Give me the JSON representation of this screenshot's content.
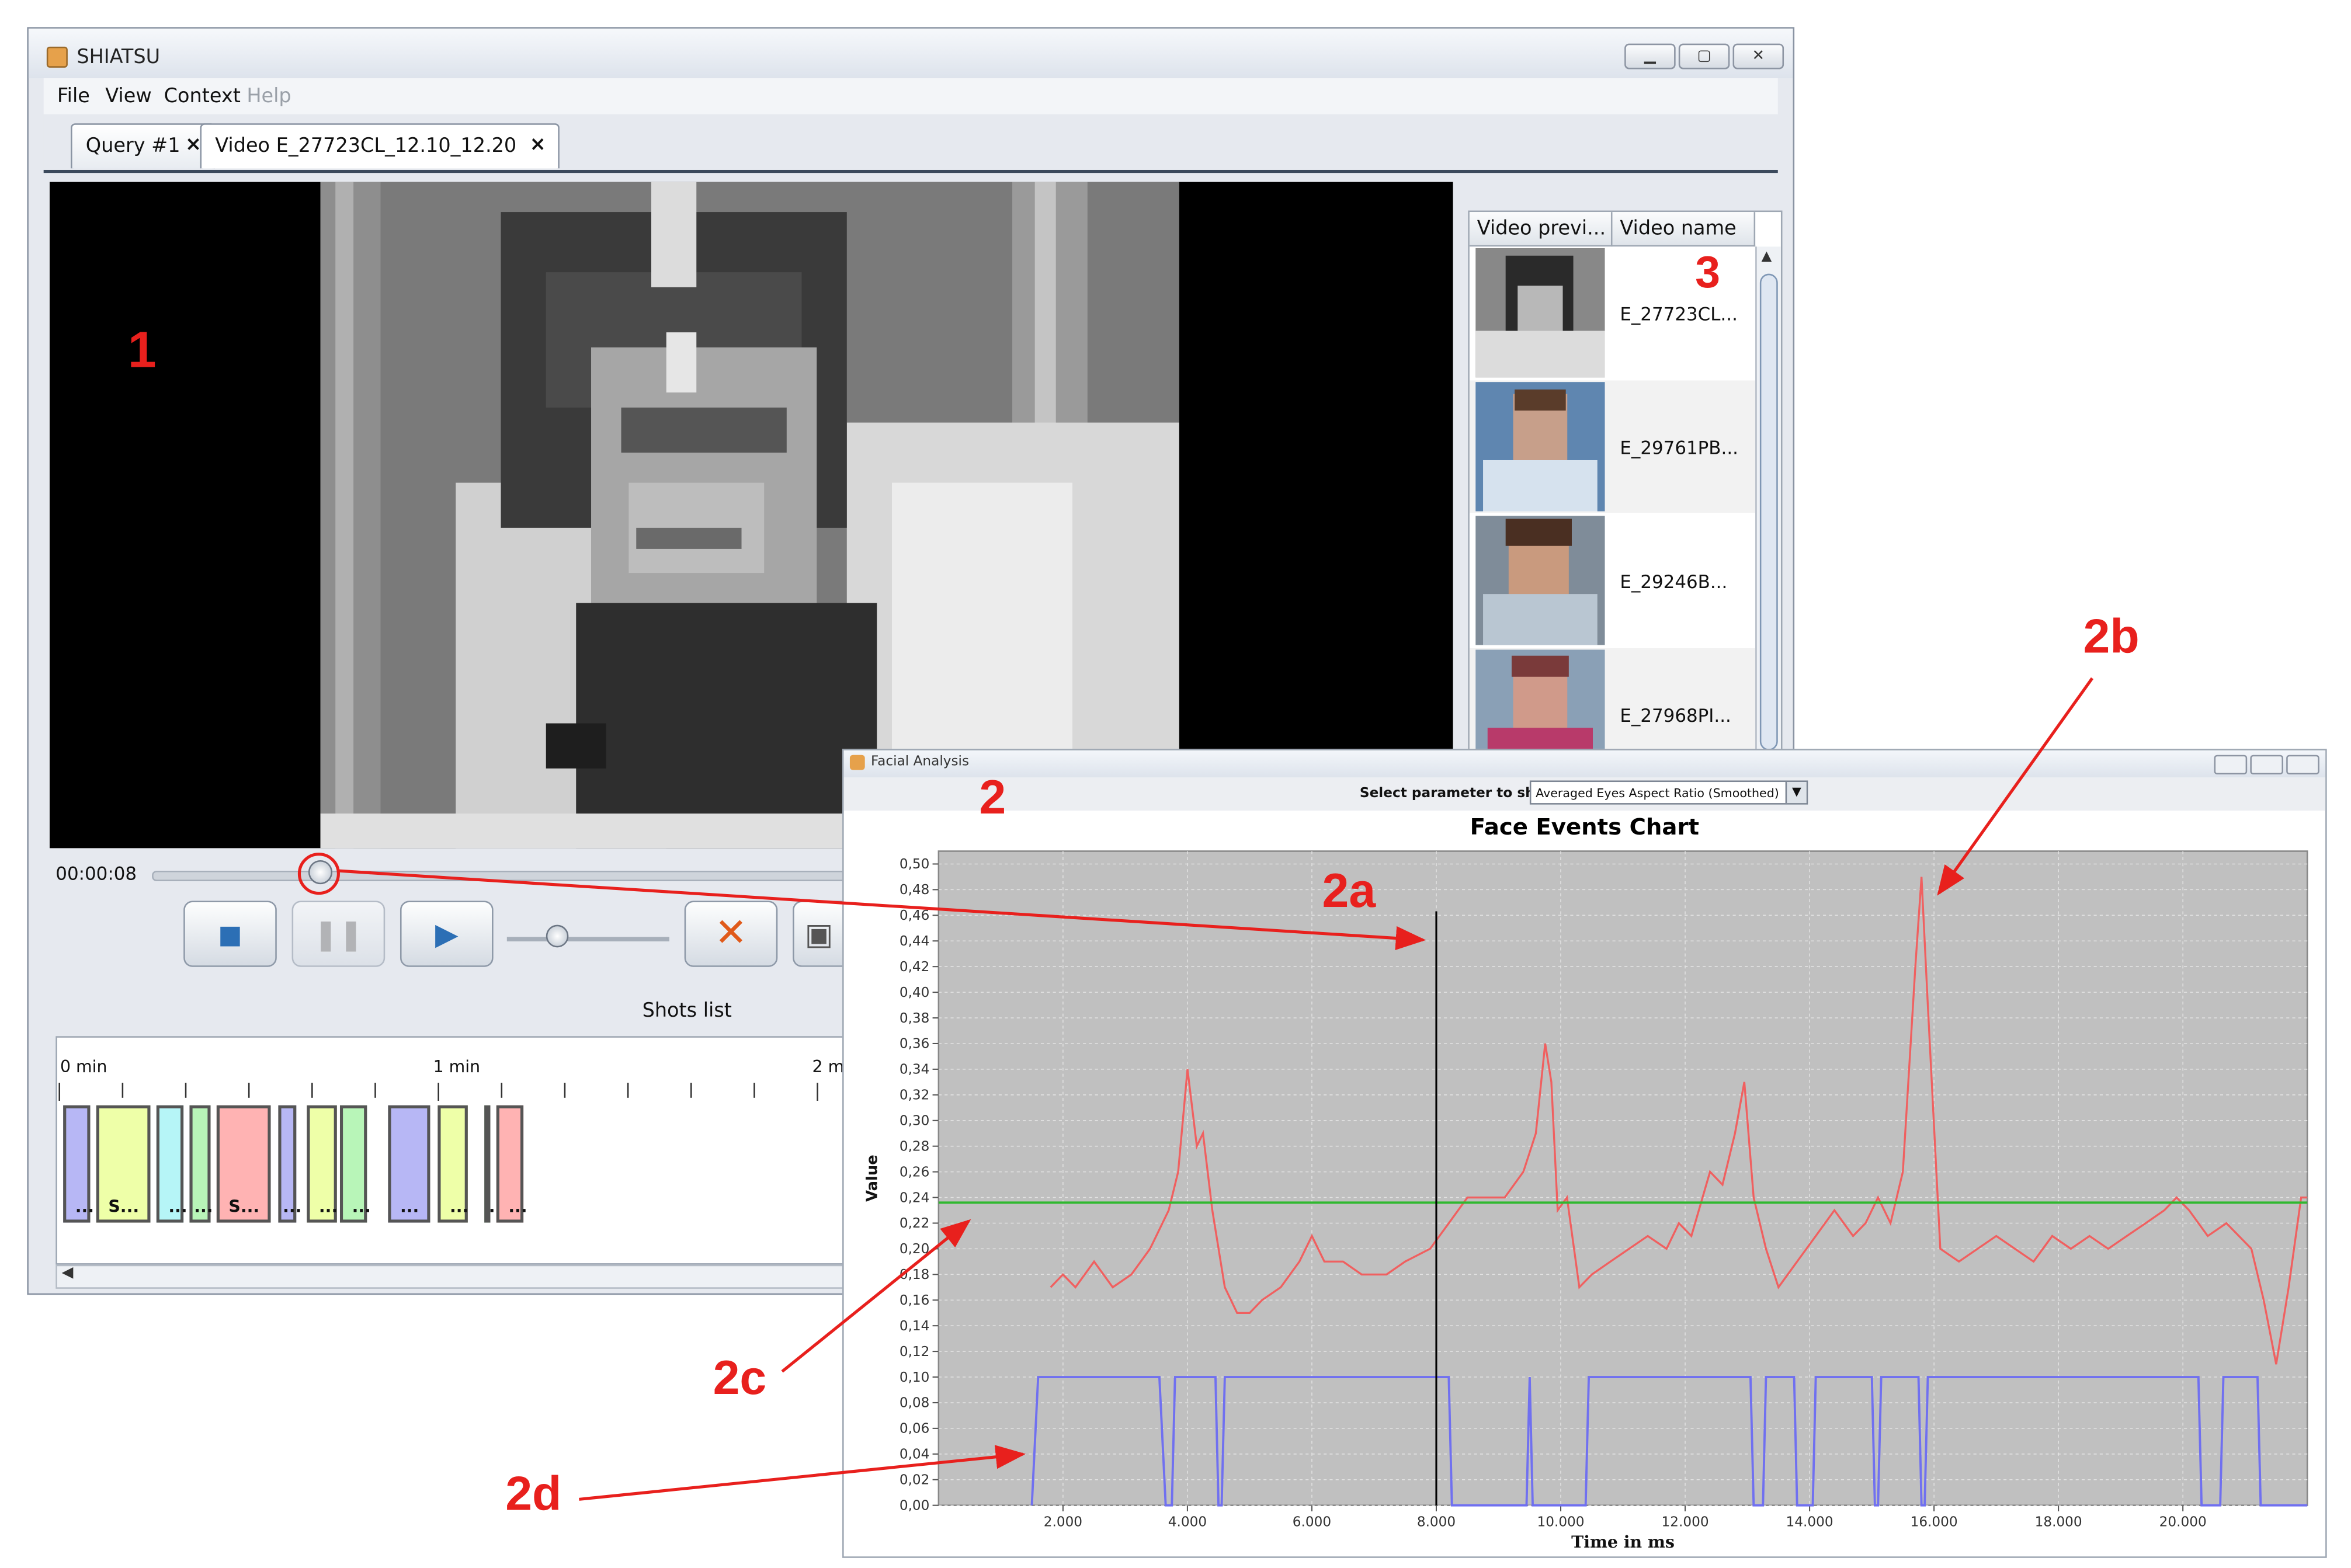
{
  "main_window": {
    "title": "SHIATSU",
    "menu": [
      "File",
      "View",
      "Context",
      "Help"
    ],
    "tabs": [
      {
        "label": "Query #1",
        "close": "×"
      },
      {
        "label": "Video E_27723CL_12.10_12.20",
        "close": "×"
      }
    ],
    "player": {
      "time": "00:00:08",
      "controls": [
        "stop-icon",
        "pause-icon",
        "play-icon",
        "mute-icon",
        "camera-icon"
      ]
    },
    "shots": {
      "label": "Shots list",
      "scale_labels": [
        "0 min",
        "1 min",
        "2 m"
      ],
      "items": [
        {
          "color": "#b7b7f5",
          "text": "..."
        },
        {
          "color": "#eeffa8",
          "text": "S..."
        },
        {
          "color": "#b6f5f7",
          "text": "..."
        },
        {
          "color": "#b8f5b8",
          "text": "..."
        },
        {
          "color": "#ffb3b3",
          "text": "S..."
        },
        {
          "color": "#b7b7f5",
          "text": "..."
        },
        {
          "color": "#eeffa8",
          "text": "..."
        },
        {
          "color": "#b8f5b8",
          "text": "..."
        },
        {
          "color": "#b7b7f5",
          "text": "..."
        },
        {
          "color": "#eeffa8",
          "text": "..."
        },
        {
          "color": "#b8f5b8",
          "text": "..."
        },
        {
          "color": "#ffb3b3",
          "text": "..."
        }
      ]
    },
    "video_table": {
      "columns": [
        "Video previ...",
        "Video name"
      ],
      "rows": [
        "E_27723CL...",
        "E_29761PB...",
        "E_29246B...",
        "E_27968PI..."
      ]
    }
  },
  "facial_analysis": {
    "title": "Facial Analysis",
    "select_label": "Select parameter to show:",
    "select_value": "Averaged Eyes Aspect Ratio (Smoothed)",
    "chart_data": {
      "type": "line",
      "title": "Face Events Chart",
      "xlabel": "Time in ms",
      "ylabel": "Value",
      "xlim": [
        0,
        22000
      ],
      "ylim": [
        0,
        0.51
      ],
      "x_ticks": [
        "2.000",
        "4.000",
        "6.000",
        "8.000",
        "10.000",
        "12.000",
        "14.000",
        "16.000",
        "18.000",
        "20.000"
      ],
      "y_ticks": [
        "0,00",
        "0,02",
        "0,04",
        "0,06",
        "0,08",
        "0,10",
        "0,12",
        "0,14",
        "0,16",
        "0,18",
        "0,20",
        "0,22",
        "0,24",
        "0,26",
        "0,28",
        "0,30",
        "0,32",
        "0,34",
        "0,36",
        "0,38",
        "0,40",
        "0,42",
        "0,44",
        "0,46",
        "0,48",
        "0,50"
      ],
      "grid": true,
      "series": [
        {
          "color": "#f06060",
          "points": [
            [
              1800,
              0.17
            ],
            [
              2000,
              0.18
            ],
            [
              2200,
              0.17
            ],
            [
              2500,
              0.19
            ],
            [
              2800,
              0.17
            ],
            [
              3100,
              0.18
            ],
            [
              3400,
              0.2
            ],
            [
              3700,
              0.23
            ],
            [
              3850,
              0.26
            ],
            [
              4000,
              0.34
            ],
            [
              4150,
              0.28
            ],
            [
              4250,
              0.29
            ],
            [
              4400,
              0.23
            ],
            [
              4600,
              0.17
            ],
            [
              4800,
              0.15
            ],
            [
              5000,
              0.15
            ],
            [
              5200,
              0.16
            ],
            [
              5500,
              0.17
            ],
            [
              5800,
              0.19
            ],
            [
              6000,
              0.21
            ],
            [
              6200,
              0.19
            ],
            [
              6500,
              0.19
            ],
            [
              6800,
              0.18
            ],
            [
              7200,
              0.18
            ],
            [
              7500,
              0.19
            ],
            [
              7900,
              0.2
            ],
            [
              8200,
              0.22
            ],
            [
              8500,
              0.24
            ],
            [
              8800,
              0.24
            ],
            [
              9100,
              0.24
            ],
            [
              9400,
              0.26
            ],
            [
              9600,
              0.29
            ],
            [
              9750,
              0.36
            ],
            [
              9850,
              0.33
            ],
            [
              9950,
              0.23
            ],
            [
              10100,
              0.24
            ],
            [
              10300,
              0.17
            ],
            [
              10500,
              0.18
            ],
            [
              10800,
              0.19
            ],
            [
              11100,
              0.2
            ],
            [
              11400,
              0.21
            ],
            [
              11700,
              0.2
            ],
            [
              11900,
              0.22
            ],
            [
              12100,
              0.21
            ],
            [
              12400,
              0.26
            ],
            [
              12600,
              0.25
            ],
            [
              12800,
              0.29
            ],
            [
              12950,
              0.33
            ],
            [
              13100,
              0.24
            ],
            [
              13300,
              0.2
            ],
            [
              13500,
              0.17
            ],
            [
              13800,
              0.19
            ],
            [
              14100,
              0.21
            ],
            [
              14400,
              0.23
            ],
            [
              14700,
              0.21
            ],
            [
              14900,
              0.22
            ],
            [
              15100,
              0.24
            ],
            [
              15300,
              0.22
            ],
            [
              15500,
              0.26
            ],
            [
              15700,
              0.42
            ],
            [
              15800,
              0.49
            ],
            [
              15900,
              0.39
            ],
            [
              16100,
              0.2
            ],
            [
              16400,
              0.19
            ],
            [
              16700,
              0.2
            ],
            [
              17000,
              0.21
            ],
            [
              17300,
              0.2
            ],
            [
              17600,
              0.19
            ],
            [
              17900,
              0.21
            ],
            [
              18200,
              0.2
            ],
            [
              18500,
              0.21
            ],
            [
              18800,
              0.2
            ],
            [
              19100,
              0.21
            ],
            [
              19400,
              0.22
            ],
            [
              19700,
              0.23
            ],
            [
              19900,
              0.24
            ],
            [
              20100,
              0.23
            ],
            [
              20400,
              0.21
            ],
            [
              20700,
              0.22
            ],
            [
              20900,
              0.21
            ],
            [
              21100,
              0.2
            ],
            [
              21300,
              0.16
            ],
            [
              21500,
              0.11
            ],
            [
              21700,
              0.17
            ],
            [
              21900,
              0.24
            ],
            [
              22000,
              0.24
            ]
          ]
        },
        {
          "color": "#7070f0",
          "points": [
            [
              1500,
              0.0
            ],
            [
              1600,
              0.1
            ],
            [
              3550,
              0.1
            ],
            [
              3650,
              0.0
            ],
            [
              3750,
              0.0
            ],
            [
              3800,
              0.1
            ],
            [
              4450,
              0.1
            ],
            [
              4500,
              0.0
            ],
            [
              4550,
              0.0
            ],
            [
              4600,
              0.1
            ],
            [
              8200,
              0.1
            ],
            [
              8250,
              0.0
            ],
            [
              9450,
              0.0
            ],
            [
              9500,
              0.1
            ],
            [
              9550,
              0.0
            ],
            [
              10400,
              0.0
            ],
            [
              10450,
              0.1
            ],
            [
              13050,
              0.1
            ],
            [
              13100,
              0.0
            ],
            [
              13250,
              0.0
            ],
            [
              13300,
              0.1
            ],
            [
              13750,
              0.1
            ],
            [
              13800,
              0.0
            ],
            [
              14050,
              0.0
            ],
            [
              14100,
              0.1
            ],
            [
              15000,
              0.1
            ],
            [
              15050,
              0.0
            ],
            [
              15100,
              0.0
            ],
            [
              15150,
              0.1
            ],
            [
              15750,
              0.1
            ],
            [
              15800,
              0.0
            ],
            [
              15850,
              0.0
            ],
            [
              15900,
              0.1
            ],
            [
              20250,
              0.1
            ],
            [
              20300,
              0.0
            ],
            [
              20600,
              0.0
            ],
            [
              20650,
              0.1
            ],
            [
              21200,
              0.1
            ],
            [
              21250,
              0.0
            ],
            [
              22000,
              0.0
            ]
          ]
        },
        {
          "color": "#2fb82f",
          "points": [
            [
              0,
              0.236
            ],
            [
              22000,
              0.236
            ]
          ]
        }
      ],
      "marker_x": 8000
    }
  },
  "annotations": {
    "labels": [
      "1",
      "2",
      "3",
      "2a",
      "2b",
      "2c",
      "2d"
    ],
    "color": "#e8201d"
  }
}
